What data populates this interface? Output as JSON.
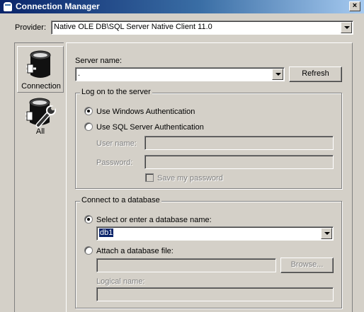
{
  "window": {
    "title": "Connection Manager",
    "close_glyph": "×"
  },
  "provider": {
    "label": "Provider:",
    "value": "Native OLE DB\\SQL Server Native Client 11.0"
  },
  "nav": {
    "items": [
      {
        "label": "Connection",
        "icon": "database-plug-icon",
        "selected": true
      },
      {
        "label": "All",
        "icon": "database-wrench-icon",
        "selected": false
      }
    ]
  },
  "server": {
    "label": "Server name:",
    "value": ".",
    "refresh_label": "Refresh"
  },
  "logon": {
    "title": "Log on to the server",
    "windows_auth_label": "Use Windows Authentication",
    "sql_auth_label": "Use SQL Server Authentication",
    "selected": "windows",
    "username_label": "User name:",
    "username_value": "",
    "password_label": "Password:",
    "password_value": "",
    "save_password_label": "Save my password",
    "save_password_checked": false
  },
  "database": {
    "title": "Connect to a database",
    "select_label": "Select or enter a database name:",
    "db_value": "db1",
    "attach_label": "Attach a database file:",
    "attach_value": "",
    "browse_label": "Browse...",
    "logical_name_label": "Logical name:",
    "logical_name_value": "",
    "selected": "select"
  },
  "colors": {
    "title_start": "#0a246a",
    "title_end": "#a6caf0",
    "face": "#d4d0c8",
    "selection": "#0a246a"
  }
}
